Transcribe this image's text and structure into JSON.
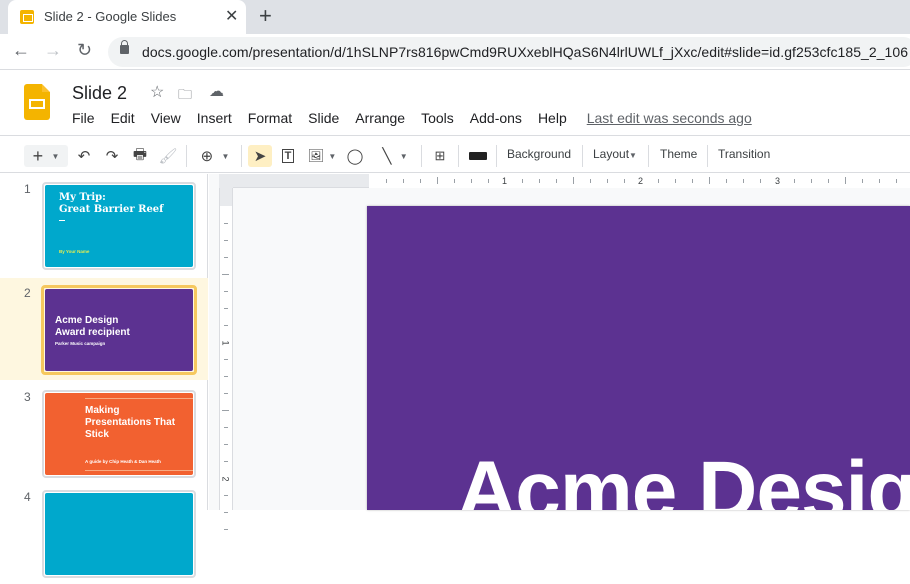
{
  "browser": {
    "tab_title": "Slide 2 - Google Slides",
    "url": "docs.google.com/presentation/d/1hSLNP7rs816pwCmd9RUXxeblHQaS6N4lrlUWLf_jXxc/edit#slide=id.gf253cfc185_2_106",
    "icons": [
      "back-icon",
      "forward-icon",
      "reload-icon",
      "lock-icon",
      "close-tab-icon",
      "new-tab-icon"
    ]
  },
  "app": {
    "doc_title": "Slide 2",
    "menu": [
      "File",
      "Edit",
      "View",
      "Insert",
      "Format",
      "Slide",
      "Arrange",
      "Tools",
      "Add-ons",
      "Help"
    ],
    "last_edit": "Last edit was seconds ago",
    "brand_color": "#f4b400"
  },
  "toolbar": {
    "background": "Background",
    "layout": "Layout",
    "theme": "Theme",
    "transition": "Transition"
  },
  "slides": [
    {
      "number": "1",
      "title_line1": "My Trip:",
      "title_line2": "Great Barrier Reef",
      "subtitle": "By Your Name",
      "color": "#00a8cc"
    },
    {
      "number": "2",
      "title_line1": "Acme Design",
      "title_line2": "Award recipient",
      "subtitle": "Parker Music campaign",
      "color": "#5c3291",
      "selected": true
    },
    {
      "number": "3",
      "title_line1": "Making",
      "title_line2": "Presentations That",
      "title_line3": "Stick",
      "subtitle": "A guide by Chip Heath & Dan Heath",
      "color": "#f26130"
    },
    {
      "number": "4",
      "color": "#00a8cc"
    }
  ],
  "ruler": {
    "h_labels": [
      "1",
      "2",
      "3"
    ],
    "v_labels": [
      "1",
      "2"
    ]
  },
  "canvas": {
    "title": "Acme Design",
    "background": "#5c3291"
  }
}
